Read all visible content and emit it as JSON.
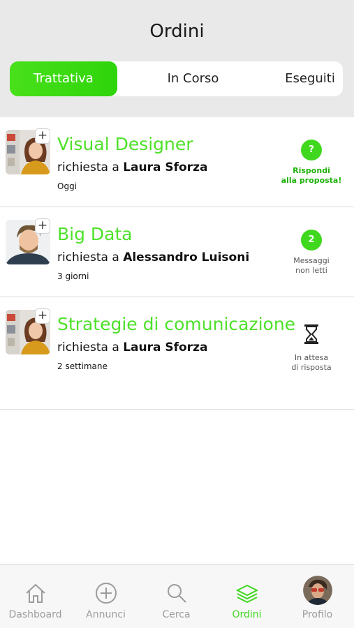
{
  "header": {
    "title": "Ordini"
  },
  "segments": [
    {
      "label": "Trattativa",
      "active": true
    },
    {
      "label": "In Corso",
      "active": false
    },
    {
      "label": "Eseguiti",
      "active": false
    }
  ],
  "orders": [
    {
      "title": "Visual Designer",
      "prefix": "richiesta a",
      "person": "Laura Sforza",
      "time": "Oggi",
      "status": {
        "badge": "?",
        "line1": "Rispondi",
        "line2": "alla proposta!"
      }
    },
    {
      "title": "Big Data",
      "prefix": "richiesta a",
      "person": "Alessandro Luisoni",
      "time": "3 giorni",
      "status": {
        "badge": "2",
        "line1": "Messaggi",
        "line2": "non letti"
      }
    },
    {
      "title": "Strategie di comunicazione",
      "prefix": "richiesta a",
      "person": "Laura Sforza",
      "time": "2 settimane",
      "status": {
        "icon": "hourglass-icon",
        "line1": "In attesa",
        "line2": "di risposta"
      }
    }
  ],
  "tabbar": [
    {
      "label": "Dashboard",
      "icon": "home-icon",
      "active": false
    },
    {
      "label": "Annunci",
      "icon": "plus-circle-icon",
      "active": false
    },
    {
      "label": "Cerca",
      "icon": "search-icon",
      "active": false
    },
    {
      "label": "Ordini",
      "icon": "layers-icon",
      "active": true
    },
    {
      "label": "Profilo",
      "icon": "avatar",
      "active": false
    }
  ],
  "colors": {
    "accent": "#3fd81e",
    "header_bg": "#e9e9e9",
    "inactive": "#9c9c9c"
  }
}
